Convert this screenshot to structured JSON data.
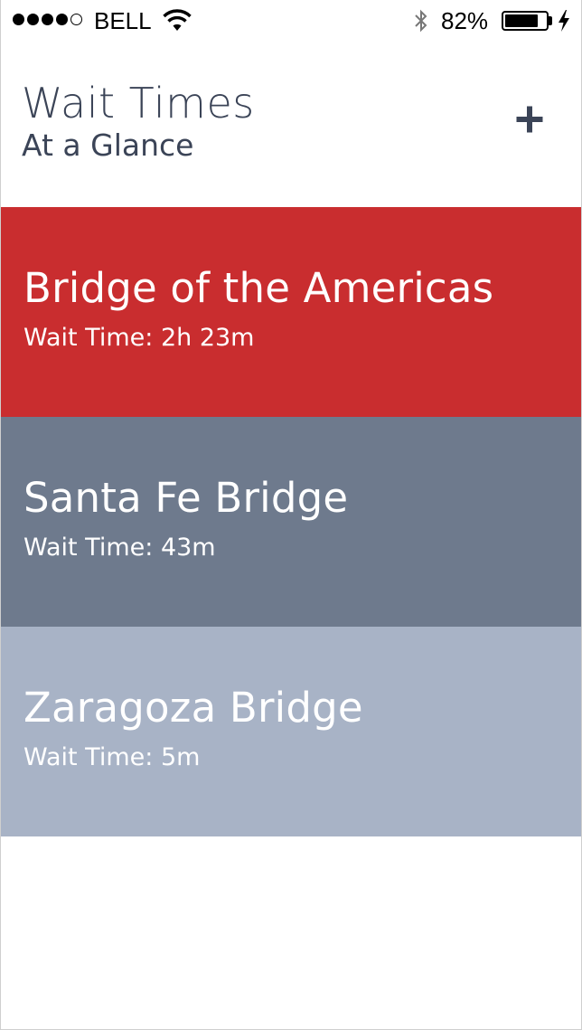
{
  "status_bar": {
    "carrier": "BELL",
    "signal_bars_filled": 4,
    "signal_bars_total": 5,
    "battery_percent": "82%",
    "battery_level": 0.82,
    "icons": [
      "signal-dots",
      "wifi-icon",
      "bluetooth-icon",
      "battery-icon",
      "charging-bolt-icon"
    ]
  },
  "header": {
    "title": "Wait Times",
    "subtitle": "At a Glance",
    "add_label": "+"
  },
  "bridges": [
    {
      "name": "Bridge of the Americas",
      "wait_label": "Wait Time: 2h 23m",
      "color": "#c92d2f"
    },
    {
      "name": "Santa Fe Bridge",
      "wait_label": "Wait Time: 43m",
      "color": "#6e7a8d"
    },
    {
      "name": "Zaragoza Bridge",
      "wait_label": "Wait Time: 5m",
      "color": "#a8b3c6"
    }
  ],
  "colors": {
    "header_text": "#3b4457",
    "row_text": "#ffffff",
    "background": "#ffffff"
  }
}
